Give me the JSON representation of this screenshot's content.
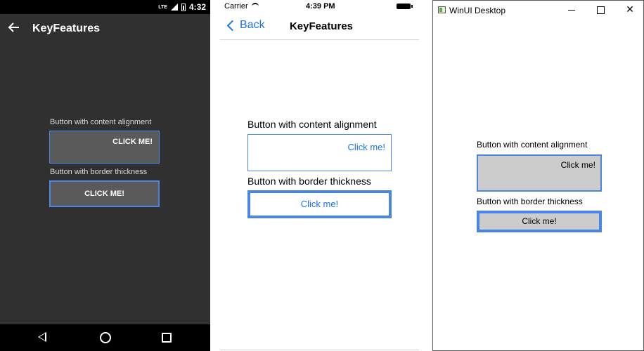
{
  "android": {
    "status": {
      "network": "LTE",
      "time": "4:32"
    },
    "toolbar": {
      "title": "KeyFeatures",
      "back_icon": "arrow-back-icon"
    },
    "label1": "Button with content alignment",
    "button1": "CLICK ME!",
    "label2": "Button with border thickness",
    "button2": "CLICK ME!",
    "nav": {
      "back_icon": "nav-back-icon",
      "home_icon": "nav-home-icon",
      "recent_icon": "nav-recent-icon"
    }
  },
  "ios": {
    "status": {
      "carrier": "Carrier",
      "time": "4:39 PM"
    },
    "nav": {
      "back_label": "Back",
      "title": "KeyFeatures"
    },
    "label1": "Button with content alignment",
    "button1": "Click me!",
    "label2": "Button with border thickness",
    "button2": "Click me!"
  },
  "winui": {
    "window_title": "WinUI Desktop",
    "label1": "Button with content alignment",
    "button1": "Click me!",
    "label2": "Button with border thickness",
    "button2": "Click me!"
  },
  "colors": {
    "accent_border": "#4a86e8",
    "ios_link": "#1a73e8",
    "android_bg": "#303030",
    "android_button": "#5a5a5a",
    "win_button": "#cccccc"
  }
}
